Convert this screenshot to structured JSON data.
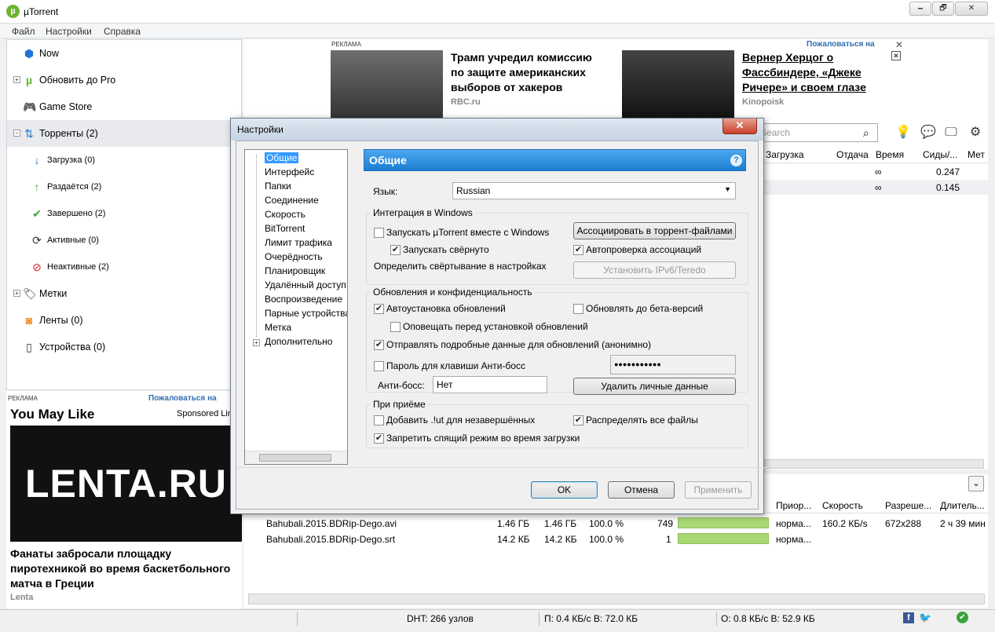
{
  "window": {
    "title": "µTorrent",
    "minimize": "🗕",
    "maximize": "🗗",
    "close": "✕"
  },
  "menu": [
    "Файл",
    "Настройки",
    "Справка"
  ],
  "sidebar": {
    "items": [
      {
        "label": "Now",
        "icon": "now-icon"
      },
      {
        "label": "Обновить до Pro",
        "icon": "utorrent-icon"
      },
      {
        "label": "Game Store",
        "icon": "gamepad-icon"
      },
      {
        "label": "Торренты (2)",
        "icon": "transfer-arrows-icon"
      },
      {
        "label": "Загрузка (0)",
        "icon": "download-arrow-icon"
      },
      {
        "label": "Раздаётся (2)",
        "icon": "upload-arrow-icon"
      },
      {
        "label": "Завершено (2)",
        "icon": "checkmark-icon"
      },
      {
        "label": "Активные (0)",
        "icon": "refresh-icon"
      },
      {
        "label": "Неактивные (2)",
        "icon": "inactive-icon"
      },
      {
        "label": "Метки",
        "icon": "label-tag-icon"
      },
      {
        "label": "Ленты (0)",
        "icon": "rss-icon"
      },
      {
        "label": "Устройства (0)",
        "icon": "device-icon"
      }
    ]
  },
  "ad_side": {
    "tag": "РЕКЛАМА",
    "report": "Пожаловаться на",
    "title": "You May Like",
    "sponsored": "Sponsored Lin",
    "image_text": "LENTA.RU",
    "headline": "Фанаты забросали площадку пиротехникой во время баскетбольного матча в Греции",
    "source": "Lenta"
  },
  "ad_top": {
    "tag": "РЕКЛАМА",
    "report": "Пожаловаться на",
    "items": [
      {
        "headline": "Трамп учредил комиссию по защите американских выборов от хакеров",
        "source": "RBC.ru"
      },
      {
        "headline": "Вернер Херцог о Фассбиндере, «Джеке Ричере» и своем глазе",
        "source": "Kinopoisk"
      }
    ],
    "close": "✕"
  },
  "search": {
    "placeholder": "Search"
  },
  "grid": {
    "headers": [
      "Загрузка",
      "Отдача",
      "Время",
      "Сиды/...",
      "Мет"
    ],
    "rows": [
      {
        "time": "∞",
        "seeds": "0.247"
      },
      {
        "time": "∞",
        "seeds": "0.145"
      }
    ]
  },
  "files": {
    "headers": [
      "Приор...",
      "Скорость",
      "Разреше...",
      "Длитель..."
    ],
    "rows": [
      {
        "name": "Bahubali.2015.BDRip-Dego.avi",
        "size": "1.46 ГБ",
        "done": "1.46 ГБ",
        "pct": "100.0 %",
        "pieces": "749",
        "progress": 1.0,
        "priority": "норма...",
        "speed": "160.2 КБ/s",
        "resolution": "672x288",
        "duration": "2 ч 39 мин"
      },
      {
        "name": "Bahubali.2015.BDRip-Dego.srt",
        "size": "14.2 КБ",
        "done": "14.2 КБ",
        "pct": "100.0 %",
        "pieces": "1",
        "progress": 1.0,
        "priority": "норма...",
        "speed": "",
        "resolution": "",
        "duration": ""
      }
    ]
  },
  "statusbar": {
    "dht": "DHT: 266 узлов",
    "down": "П: 0.4 КБ/с В: 72.0 КБ",
    "up": "О: 0.8 КБ/с В: 52.9 КБ"
  },
  "dialog": {
    "title": "Настройки",
    "close": "✕",
    "tree": [
      "Общие",
      "Интерфейс",
      "Папки",
      "Соединение",
      "Скорость",
      "BitTorrent",
      "Лимит трафика",
      "Очерёдность",
      "Планировщик",
      "Удалённый доступ",
      "Воспроизведение",
      "Парные устройства",
      "Метка",
      "Дополнительно"
    ],
    "section_title": "Общие",
    "help": "?",
    "language_label": "Язык:",
    "language_value": "Russian",
    "group_windows": "Интеграция в Windows",
    "cb_start_with_windows": "Запускать µTorrent вместе с Windows",
    "cb_start_minimized": "Запускать свёрнуто",
    "btn_associate": "Ассоциировать в торрент-файлами",
    "cb_auto_check": "Автопроверка ассоциаций",
    "define_minimize": "Определить свёртывание в настройках",
    "btn_ipv6": "Установить IPv6/Teredo",
    "group_updates": "Обновления и конфиденциальность",
    "cb_auto_update": "Автоустановка обновлений",
    "cb_beta": "Обновлять до бета-версий",
    "cb_notify": "Оповещать перед установкой обновлений",
    "cb_send_data": "Отправлять подробные данные для обновлений (анонимно)",
    "cb_boss_pass": "Пароль для клавиши Анти-босс",
    "boss_pass_value": "●●●●●●●●●●●",
    "anti_boss_label": "Анти-босс:",
    "anti_boss_value": "Нет",
    "btn_delete_private": "Удалить личные данные",
    "group_receive": "При приёме",
    "cb_add_ut": "Добавить .!ut для незавершённых",
    "cb_distribute": "Распределять все файлы",
    "cb_no_sleep": "Запретить спящий режим во время загрузки",
    "btn_ok": "OK",
    "btn_cancel": "Отмена",
    "btn_apply": "Применить"
  }
}
